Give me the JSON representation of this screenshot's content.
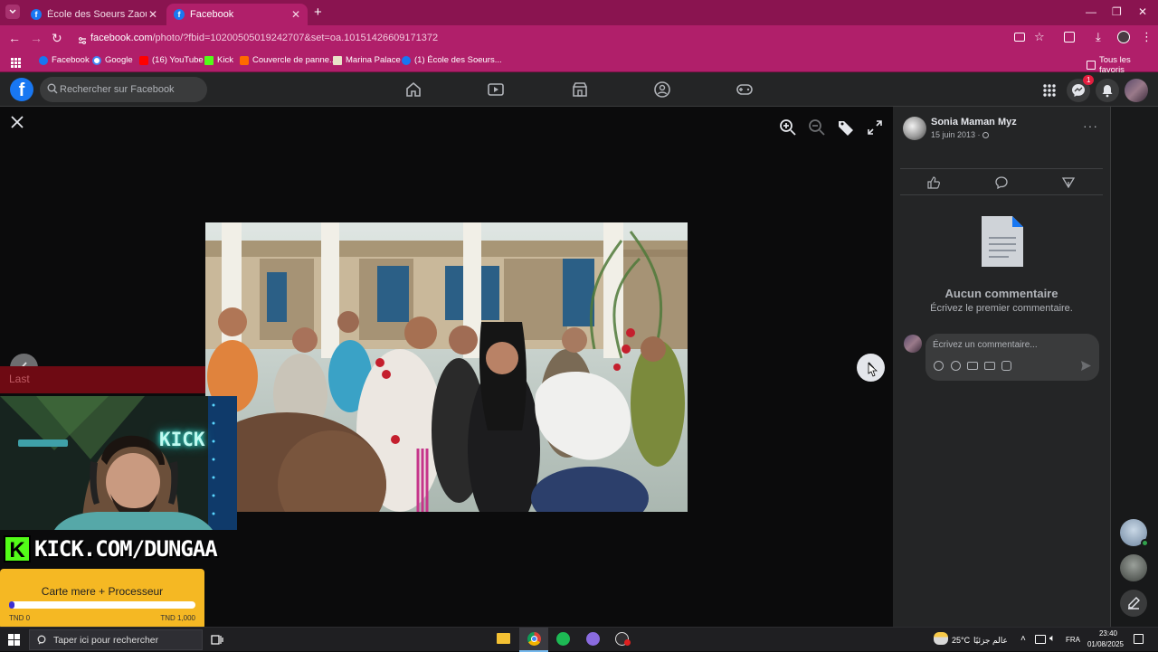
{
  "browser": {
    "tabs": [
      {
        "title": "École des Soeurs Zaouia Bokria",
        "active": false
      },
      {
        "title": "Facebook",
        "active": true
      }
    ],
    "url_host": "facebook.com",
    "url_path": "/photo/?fbid=10200505019242707&set=oa.10151426609171372",
    "bookmarks": [
      {
        "label": "Facebook",
        "icon": "facebook-icon"
      },
      {
        "label": "Google",
        "icon": "google-icon"
      },
      {
        "label": "(16) YouTube",
        "icon": "youtube-icon"
      },
      {
        "label": "Kick",
        "icon": "kick-icon"
      },
      {
        "label": "Couvercle de panne...",
        "icon": "aliexpress-icon"
      },
      {
        "label": "Marina Palace",
        "icon": "hotel-icon"
      },
      {
        "label": "(1) École des Soeurs...",
        "icon": "facebook-icon"
      }
    ],
    "all_bookmarks": "Tous les favoris"
  },
  "facebook": {
    "search_placeholder": "Rechercher sur Facebook",
    "messenger_badge": "1",
    "post": {
      "author": "Sonia Maman Myz",
      "date": "15 juin 2013 · "
    },
    "no_comments": "Aucun commentaire",
    "first_comment": "Écrivez le premier commentaire.",
    "comment_placeholder": "Écrivez un commentaire..."
  },
  "stream": {
    "banner_left": "Last",
    "banner_right": "",
    "webcam_sign": "KICK",
    "tag": "KICK.COM/DUNGAA",
    "goal": {
      "title": "Carte mere + Processeur",
      "min": "TND 0",
      "max": "TND 1,000",
      "progress": 0.03
    }
  },
  "taskbar": {
    "search": "Taper ici pour rechercher",
    "weather": "25°C",
    "weather_text": "عالم جزئيًا",
    "lang": "FRA",
    "time": "23:40",
    "date": "01/08/2025"
  },
  "colors": {
    "browser_frame": "#8a1450",
    "toolbar": "#b01f6a",
    "fb_blue": "#1877f2",
    "kick_green": "#53fc18",
    "goal_yellow": "#f5b823"
  }
}
